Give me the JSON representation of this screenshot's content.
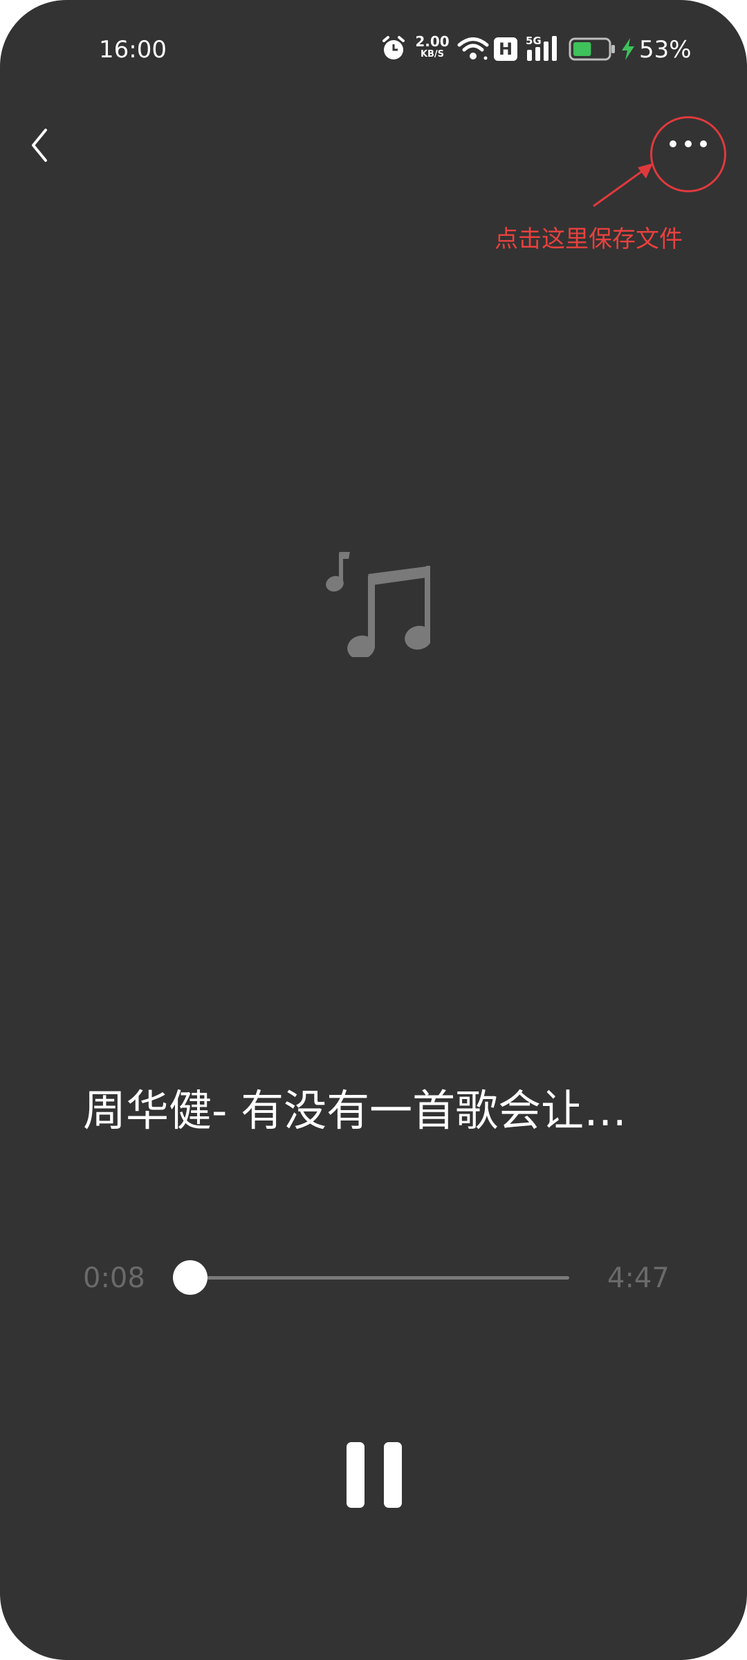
{
  "status_bar": {
    "time": "16:00",
    "net_speed_value": "2.00",
    "net_speed_unit": "KB/S",
    "hd_label": "H",
    "network_type": "5G",
    "battery_percent": "53%",
    "battery_level": 0.53,
    "icons": [
      "alarm-icon",
      "wifi-icon",
      "hd-icon",
      "signal-icon",
      "battery-icon",
      "charging-icon"
    ]
  },
  "header": {
    "back_icon": "chevron-left-icon",
    "more_icon": "more-dots-icon"
  },
  "annotation": {
    "text": "点击这里保存文件",
    "color": "#e8413e"
  },
  "player": {
    "artwork_icon": "music-note-icon",
    "title": "周华健- 有没有一首歌会让…",
    "current_time": "0:08",
    "total_time": "4:47",
    "progress": 0.03,
    "control_icon": "pause-icon"
  },
  "colors": {
    "background": "#333333",
    "annotation": "#e8413e"
  }
}
